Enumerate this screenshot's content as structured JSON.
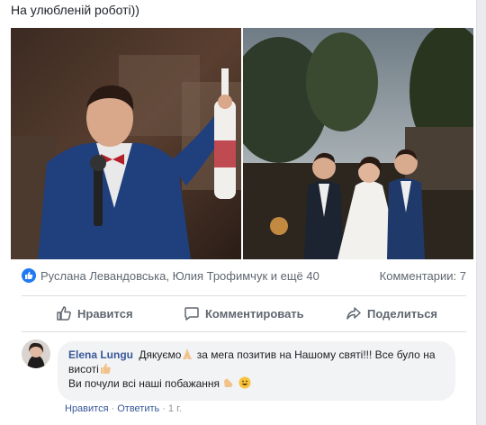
{
  "post": {
    "text": "На улюбленій роботі))"
  },
  "reactions": {
    "names": "Руслана Левандовська, Юлия Трофимчук и ещё 40",
    "comments": "Комментарии: 7"
  },
  "actions": {
    "like": "Нравится",
    "comment": "Комментировать",
    "share": "Поделиться"
  },
  "comment": {
    "author": "Elena Lungu",
    "text_part1": "Дякуємо",
    "text_part2": "за мега позитив на Нашому святі!!! Все було на висоті",
    "text_line2": "Ви почули всі наші побажання",
    "like_link": "Нравится",
    "reply_link": "Ответить",
    "time": "1 г."
  },
  "colors": {
    "link": "#385898",
    "accent": "#2078f4",
    "muted": "#606770"
  }
}
